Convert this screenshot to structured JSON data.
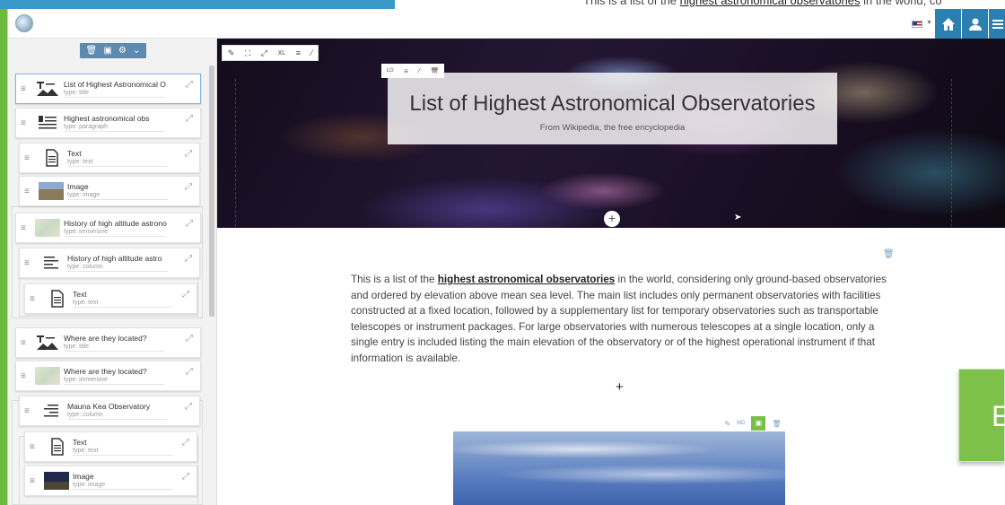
{
  "background_page": {
    "text_before": "This is a list of the ",
    "link": "highest astronomical observatories",
    "text_after": " in the world, co"
  },
  "topbar": {
    "logo_icon": "globe-icon",
    "flag_icon": "us-flag-icon",
    "home_icon": "home-icon",
    "user_icon": "user-icon",
    "menu_icon": "menu-icon",
    "accent": "#2b80b0"
  },
  "panel": {
    "tools": [
      "trash-icon",
      "file-icon",
      "gear-icon",
      "chevron-down-icon"
    ],
    "items": [
      {
        "name": "List of Highest Astronomical O",
        "type": "type: title",
        "icon": "title-icon"
      },
      {
        "name": "Highest astronomical obs",
        "type": "type: paragraph",
        "icon": "paragraph-icon"
      },
      {
        "name": "Text",
        "type": "type: text",
        "icon": "document-icon"
      },
      {
        "name": "Image",
        "type": "type: image",
        "icon": "image-thumb"
      },
      {
        "name": "History of high altitude astrono",
        "type": "type: immersive",
        "icon": "map-thumb"
      },
      {
        "name": "History of high altitude astro",
        "type": "type: column",
        "icon": "column-icon"
      },
      {
        "name": "Text",
        "type": "type: text",
        "icon": "document-icon"
      },
      {
        "name": "Where are they located?",
        "type": "type: title",
        "icon": "title-icon"
      },
      {
        "name": "Where are they located?",
        "type": "type: immersive",
        "icon": "map-thumb"
      },
      {
        "name": "Mauna Kea Observatory",
        "type": "type: column",
        "icon": "column-icon"
      },
      {
        "name": "Text",
        "type": "type: text",
        "icon": "document-icon"
      },
      {
        "name": "Image",
        "type": "type: image",
        "icon": "image-thumb"
      }
    ]
  },
  "hero": {
    "tools": [
      "pencil-icon",
      "fit-icon",
      "expand-icon",
      "XL",
      "align-icon",
      "pipette-icon"
    ],
    "mini_tools": [
      "LG",
      "align-icon",
      "pipette-icon",
      "trash-icon"
    ],
    "title": "List of Highest Astronomical Observatories",
    "subtitle": "From Wikipedia, the free encyclopedia"
  },
  "body": {
    "para_before": "This is a list of the ",
    "para_link": "highest astronomical observatories",
    "para_after": " in the world, considering only ground-based observatories and ordered by elevation above mean sea level. The main list includes only permanent observatories with facilities constructed at a fixed location, followed by a supplementary list for temporary observatories such as transportable telescopes or instrument packages. For large observatories with numerous telescopes at a single location, only a single entry is included listing the main elevation of the observatory or of the highest operational instrument if that information is available.",
    "add_symbol": "+",
    "image_tools": [
      "pencil-icon",
      "MD",
      "image-mode-icon",
      "trash-icon"
    ]
  },
  "side_box": {
    "letter": "E"
  }
}
